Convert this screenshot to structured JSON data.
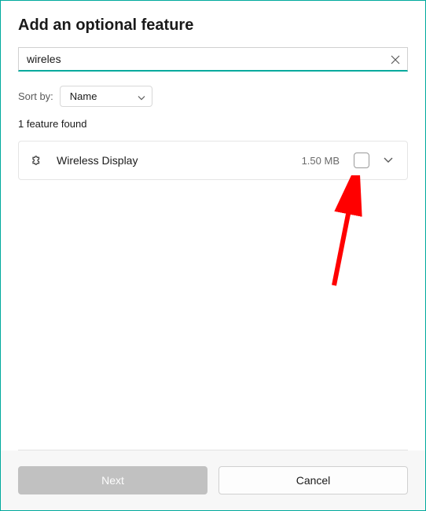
{
  "dialog": {
    "title": "Add an optional feature"
  },
  "search": {
    "value": "wireles",
    "placeholder": ""
  },
  "sort": {
    "label": "Sort by:",
    "selected": "Name"
  },
  "results": {
    "count_text": "1 feature found",
    "items": [
      {
        "name": "Wireless Display",
        "size": "1.50 MB",
        "checked": false
      }
    ]
  },
  "footer": {
    "next": "Next",
    "cancel": "Cancel"
  }
}
